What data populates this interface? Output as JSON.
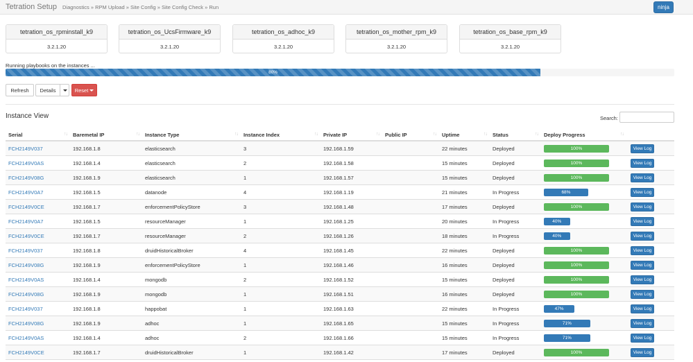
{
  "header": {
    "title": "Tetration Setup",
    "breadcrumb": "Diagnostics » RPM Upload » Site Config » Site Config Check » Run",
    "user": "ninja"
  },
  "rpm_cards": [
    {
      "name": "tetration_os_rpminstall_k9",
      "version": "3.2.1.20"
    },
    {
      "name": "tetration_os_UcsFirmware_k9",
      "version": "3.2.1.20"
    },
    {
      "name": "tetration_os_adhoc_k9",
      "version": "3.2.1.20"
    },
    {
      "name": "tetration_os_mother_rpm_k9",
      "version": "3.2.1.20"
    },
    {
      "name": "tetration_os_base_rpm_k9",
      "version": "3.2.1.20"
    }
  ],
  "overall": {
    "message": "Running playbooks on the instances ...",
    "percent": 80,
    "label": "80%"
  },
  "toolbar": {
    "refresh": "Refresh",
    "details": "Details",
    "reset": "Reset"
  },
  "instance_view": {
    "title": "Instance View",
    "search_label": "Search:",
    "search_value": "",
    "columns": [
      "Serial",
      "Baremetal IP",
      "Instance Type",
      "Instance Index",
      "Private IP",
      "Public IP",
      "Uptime",
      "Status",
      "Deploy Progress",
      ""
    ],
    "view_log_label": "View Log",
    "rows": [
      {
        "serial": "FCH2149V037",
        "baremetal_ip": "192.168.1.8",
        "type": "elasticsearch",
        "index": "3",
        "private_ip": "192.168.1.59",
        "public_ip": "",
        "uptime": "22 minutes",
        "status": "Deployed",
        "progress": 100,
        "progress_label": "100%"
      },
      {
        "serial": "FCH2149V0AS",
        "baremetal_ip": "192.168.1.4",
        "type": "elasticsearch",
        "index": "2",
        "private_ip": "192.168.1.58",
        "public_ip": "",
        "uptime": "15 minutes",
        "status": "Deployed",
        "progress": 100,
        "progress_label": "100%"
      },
      {
        "serial": "FCH2149V08G",
        "baremetal_ip": "192.168.1.9",
        "type": "elasticsearch",
        "index": "1",
        "private_ip": "192.168.1.57",
        "public_ip": "",
        "uptime": "15 minutes",
        "status": "Deployed",
        "progress": 100,
        "progress_label": "100%"
      },
      {
        "serial": "FCH2149V0A7",
        "baremetal_ip": "192.168.1.5",
        "type": "datanode",
        "index": "4",
        "private_ip": "192.168.1.19",
        "public_ip": "",
        "uptime": "21 minutes",
        "status": "In Progress",
        "progress": 68,
        "progress_label": "68%"
      },
      {
        "serial": "FCH2149V0CE",
        "baremetal_ip": "192.168.1.7",
        "type": "enforcementPolicyStore",
        "index": "3",
        "private_ip": "192.168.1.48",
        "public_ip": "",
        "uptime": "17 minutes",
        "status": "Deployed",
        "progress": 100,
        "progress_label": "100%"
      },
      {
        "serial": "FCH2149V0A7",
        "baremetal_ip": "192.168.1.5",
        "type": "resourceManager",
        "index": "1",
        "private_ip": "192.168.1.25",
        "public_ip": "",
        "uptime": "20 minutes",
        "status": "In Progress",
        "progress": 40,
        "progress_label": "40%"
      },
      {
        "serial": "FCH2149V0CE",
        "baremetal_ip": "192.168.1.7",
        "type": "resourceManager",
        "index": "2",
        "private_ip": "192.168.1.26",
        "public_ip": "",
        "uptime": "18 minutes",
        "status": "In Progress",
        "progress": 40,
        "progress_label": "40%"
      },
      {
        "serial": "FCH2149V037",
        "baremetal_ip": "192.168.1.8",
        "type": "druidHistoricalBroker",
        "index": "4",
        "private_ip": "192.168.1.45",
        "public_ip": "",
        "uptime": "22 minutes",
        "status": "Deployed",
        "progress": 100,
        "progress_label": "100%"
      },
      {
        "serial": "FCH2149V08G",
        "baremetal_ip": "192.168.1.9",
        "type": "enforcementPolicyStore",
        "index": "1",
        "private_ip": "192.168.1.46",
        "public_ip": "",
        "uptime": "16 minutes",
        "status": "Deployed",
        "progress": 100,
        "progress_label": "100%"
      },
      {
        "serial": "FCH2149V0AS",
        "baremetal_ip": "192.168.1.4",
        "type": "mongodb",
        "index": "2",
        "private_ip": "192.168.1.52",
        "public_ip": "",
        "uptime": "15 minutes",
        "status": "Deployed",
        "progress": 100,
        "progress_label": "100%"
      },
      {
        "serial": "FCH2149V08G",
        "baremetal_ip": "192.168.1.9",
        "type": "mongodb",
        "index": "1",
        "private_ip": "192.168.1.51",
        "public_ip": "",
        "uptime": "16 minutes",
        "status": "Deployed",
        "progress": 100,
        "progress_label": "100%"
      },
      {
        "serial": "FCH2149V037",
        "baremetal_ip": "192.168.1.8",
        "type": "happobat",
        "index": "1",
        "private_ip": "192.168.1.63",
        "public_ip": "",
        "uptime": "22 minutes",
        "status": "In Progress",
        "progress": 47,
        "progress_label": "47%"
      },
      {
        "serial": "FCH2149V08G",
        "baremetal_ip": "192.168.1.9",
        "type": "adhoc",
        "index": "1",
        "private_ip": "192.168.1.65",
        "public_ip": "",
        "uptime": "15 minutes",
        "status": "In Progress",
        "progress": 71,
        "progress_label": "71%"
      },
      {
        "serial": "FCH2149V0AS",
        "baremetal_ip": "192.168.1.4",
        "type": "adhoc",
        "index": "2",
        "private_ip": "192.168.1.66",
        "public_ip": "",
        "uptime": "15 minutes",
        "status": "In Progress",
        "progress": 71,
        "progress_label": "71%"
      },
      {
        "serial": "FCH2149V0CE",
        "baremetal_ip": "192.168.1.7",
        "type": "druidHistoricalBroker",
        "index": "1",
        "private_ip": "192.168.1.42",
        "public_ip": "",
        "uptime": "17 minutes",
        "status": "Deployed",
        "progress": 100,
        "progress_label": "100%"
      }
    ]
  },
  "colors": {
    "primary": "#337ab7",
    "success": "#5cb85c",
    "danger": "#d9534f"
  }
}
